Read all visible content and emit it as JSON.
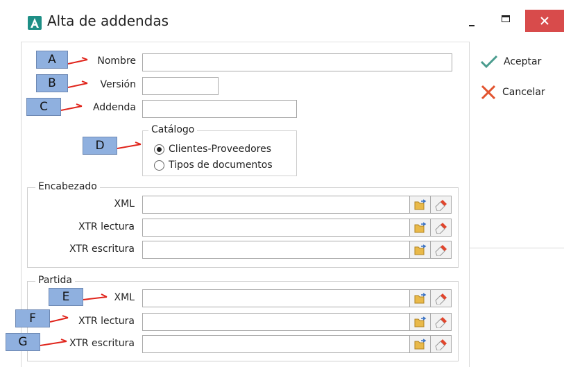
{
  "window": {
    "title": "Alta de addendas",
    "minimize": "minimize",
    "maximize": "maximize",
    "close": "close"
  },
  "actions": {
    "accept": "Aceptar",
    "cancel": "Cancelar",
    "accept_color": "#4a9c8e",
    "cancel_color": "#e2542f"
  },
  "form": {
    "nombre_label": "Nombre",
    "nombre_value": "",
    "version_label": "Versión",
    "version_value": "",
    "addenda_label": "Addenda",
    "addenda_value": ""
  },
  "catalogo": {
    "title": "Catálogo",
    "options": [
      "Clientes-Proveedores",
      "Tipos de documentos"
    ],
    "selected": "Clientes-Proveedores"
  },
  "encabezado": {
    "title": "Encabezado",
    "rows": [
      {
        "label": "XML",
        "value": ""
      },
      {
        "label": "XTR lectura",
        "value": ""
      },
      {
        "label": "XTR escritura",
        "value": ""
      }
    ]
  },
  "partida": {
    "title": "Partida",
    "rows": [
      {
        "label": "XML",
        "value": ""
      },
      {
        "label": "XTR lectura",
        "value": ""
      },
      {
        "label": "XTR escritura",
        "value": ""
      }
    ]
  },
  "callouts": [
    "A",
    "B",
    "C",
    "D",
    "E",
    "F",
    "G"
  ],
  "colors": {
    "callout_fill": "#8fb0df",
    "callout_arrow": "#e0241b",
    "close_button": "#d84b4b",
    "app_icon": "#1e8f86"
  },
  "icons": {
    "app": "app-logo-icon",
    "accept": "checkmark-icon",
    "cancel": "x-icon",
    "browse": "folder-open-icon",
    "clear": "eraser-icon"
  }
}
